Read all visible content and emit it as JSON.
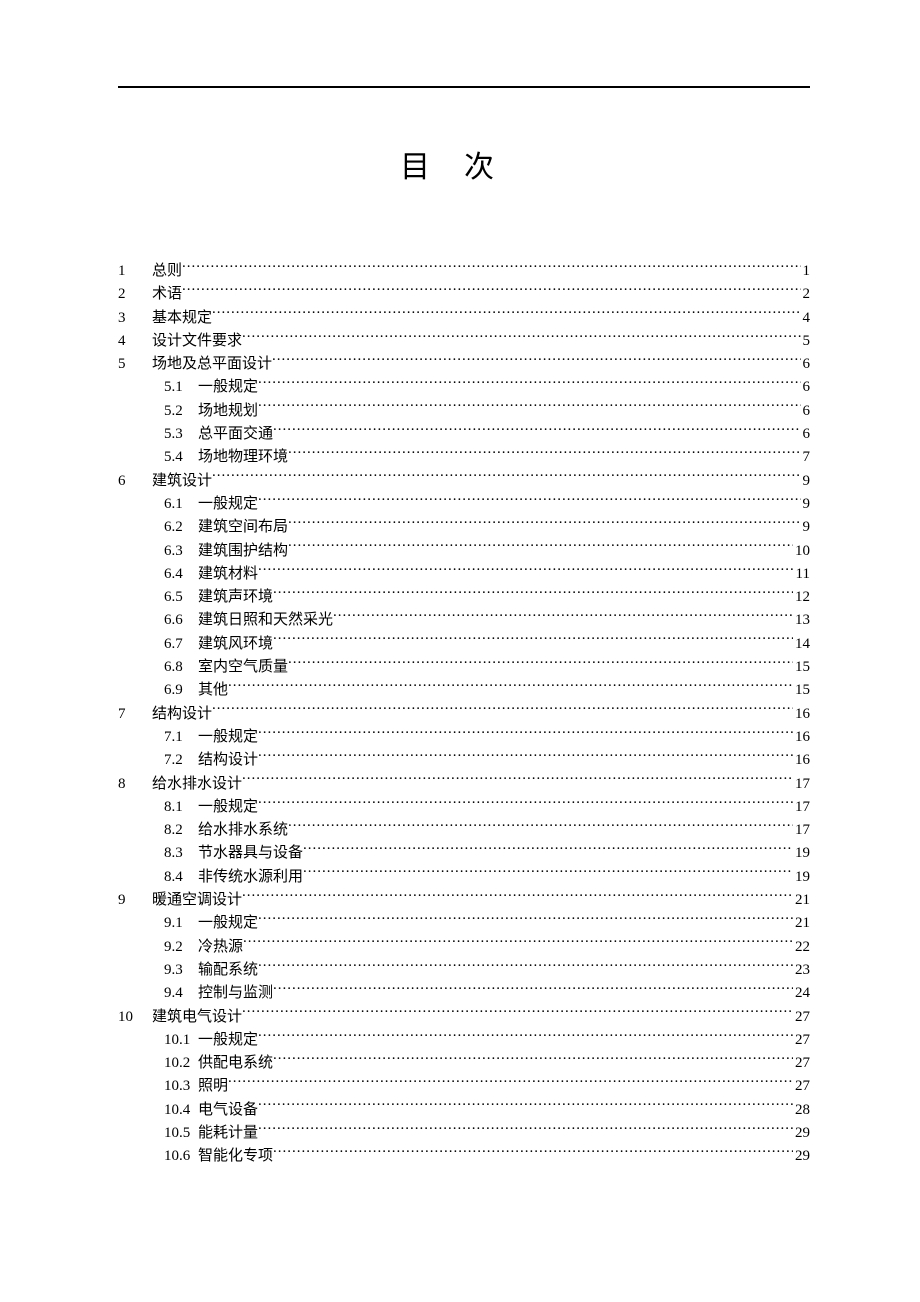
{
  "title": "目次",
  "entries": [
    {
      "num": "1",
      "label": "总则",
      "page": "1",
      "level": 0
    },
    {
      "num": "2",
      "label": "术语",
      "page": "2",
      "level": 0
    },
    {
      "num": "3",
      "label": "基本规定",
      "page": "4",
      "level": 0
    },
    {
      "num": "4",
      "label": "设计文件要求",
      "page": "5",
      "level": 0
    },
    {
      "num": "5",
      "label": "场地及总平面设计",
      "page": "6",
      "level": 0
    },
    {
      "num": "5.1",
      "label": "一般规定",
      "page": "6",
      "level": 1
    },
    {
      "num": "5.2",
      "label": "场地规划",
      "page": "6",
      "level": 1
    },
    {
      "num": "5.3",
      "label": "总平面交通",
      "page": "6",
      "level": 1
    },
    {
      "num": "5.4",
      "label": "场地物理环境",
      "page": "7",
      "level": 1
    },
    {
      "num": "6",
      "label": "建筑设计",
      "page": "9",
      "level": 0
    },
    {
      "num": "6.1",
      "label": "一般规定",
      "page": "9",
      "level": 1
    },
    {
      "num": "6.2",
      "label": "建筑空间布局",
      "page": "9",
      "level": 1
    },
    {
      "num": "6.3",
      "label": "建筑围护结构",
      "page": "10",
      "level": 1
    },
    {
      "num": "6.4",
      "label": "建筑材料",
      "page": "11",
      "level": 1
    },
    {
      "num": "6.5",
      "label": "建筑声环境",
      "page": "12",
      "level": 1
    },
    {
      "num": "6.6",
      "label": "建筑日照和天然采光",
      "page": "13",
      "level": 1
    },
    {
      "num": "6.7",
      "label": "建筑风环境",
      "page": "14",
      "level": 1
    },
    {
      "num": "6.8",
      "label": "室内空气质量",
      "page": "15",
      "level": 1
    },
    {
      "num": "6.9",
      "label": "其他",
      "page": "15",
      "level": 1
    },
    {
      "num": "7",
      "label": "结构设计",
      "page": "16",
      "level": 0
    },
    {
      "num": "7.1",
      "label": "一般规定",
      "page": "16",
      "level": 1
    },
    {
      "num": "7.2",
      "label": "结构设计",
      "page": "16",
      "level": 1
    },
    {
      "num": "8",
      "label": "给水排水设计",
      "page": "17",
      "level": 0
    },
    {
      "num": "8.1",
      "label": "一般规定",
      "page": "17",
      "level": 1
    },
    {
      "num": "8.2",
      "label": "给水排水系统",
      "page": "17",
      "level": 1
    },
    {
      "num": "8.3",
      "label": "节水器具与设备",
      "page": "19",
      "level": 1
    },
    {
      "num": "8.4",
      "label": "非传统水源利用",
      "page": "19",
      "level": 1
    },
    {
      "num": "9",
      "label": "暖通空调设计",
      "page": "21",
      "level": 0
    },
    {
      "num": "9.1",
      "label": "一般规定",
      "page": "21",
      "level": 1
    },
    {
      "num": "9.2",
      "label": "冷热源",
      "page": "22",
      "level": 1
    },
    {
      "num": "9.3",
      "label": "输配系统",
      "page": "23",
      "level": 1
    },
    {
      "num": "9.4",
      "label": "控制与监测",
      "page": "24",
      "level": 1
    },
    {
      "num": "10",
      "label": "建筑电气设计",
      "page": "27",
      "level": 0
    },
    {
      "num": "10.1",
      "label": "一般规定",
      "page": "27",
      "level": 1
    },
    {
      "num": "10.2",
      "label": "供配电系统",
      "page": "27",
      "level": 1
    },
    {
      "num": "10.3",
      "label": "照明",
      "page": "27",
      "level": 1
    },
    {
      "num": "10.4",
      "label": "电气设备",
      "page": "28",
      "level": 1
    },
    {
      "num": "10.5",
      "label": "能耗计量",
      "page": "29",
      "level": 1
    },
    {
      "num": "10.6",
      "label": "智能化专项",
      "page": "29",
      "level": 1
    }
  ]
}
